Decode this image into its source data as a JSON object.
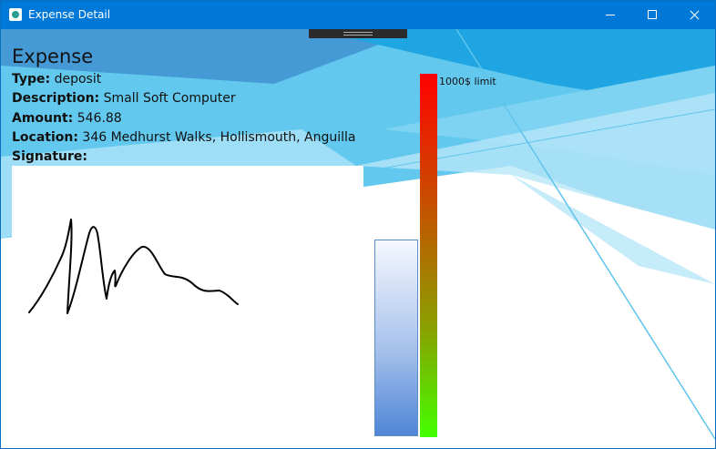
{
  "window": {
    "title": "Expense Detail",
    "icon": "app-icon",
    "controls": [
      "minimize-icon",
      "maximize-icon",
      "close-icon"
    ],
    "accent_color": "#0078d7"
  },
  "expense": {
    "heading": "Expense",
    "type_label": "Type:",
    "type_value": "deposit",
    "description_label": "Description:",
    "description_value": "Small Soft Computer",
    "amount_label": "Amount:",
    "amount_value": "546.88",
    "location_label": "Location:",
    "location_value": "346 Medhurst Walks, Hollismouth, Anguilla",
    "signature_label": "Signature:"
  },
  "chart": {
    "limit_label": "1000$ limit",
    "amount": 546.88,
    "limit": 1000,
    "amount_fraction": 0.547
  }
}
